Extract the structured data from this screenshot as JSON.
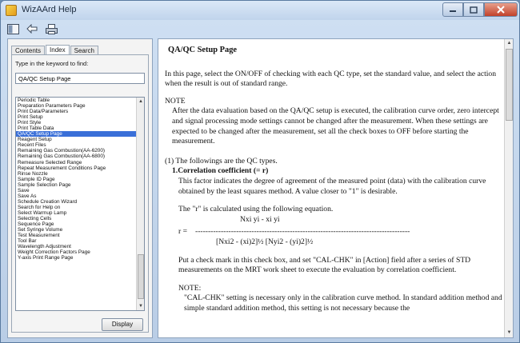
{
  "window": {
    "title": "WizAArd Help"
  },
  "toolbar": {
    "icons": [
      "hide-pane-icon",
      "back-icon",
      "print-icon"
    ]
  },
  "nav": {
    "tabs": [
      "Contents",
      "Index",
      "Search"
    ],
    "active_tab": "Index",
    "keyword_label": "Type in the keyword to find:",
    "keyword_value": "QA/QC Setup Page",
    "items": [
      "Periodic Table",
      "Preparation Parameters Page",
      "Print Data/Parameters",
      "Print Setup",
      "Print Style",
      "Print Table Data",
      "QA/QC Setup Page",
      "Reagent Setup",
      "Recent Files",
      "Remaining Gas Combustion(AA-6200)",
      "Remaining Gas Combustion(AA-6800)",
      "Remeasure Selected Range",
      "Repeat Measurement Conditions Page",
      "Rinse Nozzle",
      "Sample ID Page",
      "Sample Selection Page",
      "Save",
      "Save As",
      "Schedule Creation Wizard",
      "Search for Help on",
      "Select Warmup Lamp",
      "Selecting Cells",
      "Sequence Page",
      "Set Syringe Volume",
      "Test Measurement",
      "Tool Bar",
      "Wavelength Adjustment",
      "Weight Correction Factors Page",
      "Y-axis Print Range Page"
    ],
    "selected_index": 6,
    "display_label": "Display"
  },
  "doc": {
    "title": "QA/QC Setup Page",
    "intro": "In this page, select the ON/OFF of checking with each QC type, set the standard value, and select the action when the result is out of standard range.",
    "note_heading": "NOTE",
    "note_text": "After the data evaluation based on the QA/QC setup is executed, the calibration curve order, zero intercept and signal processing mode settings cannot be changed after the measurement. When these settings are expected to be changed after the measurement, set all the check boxes to OFF before starting the measurement.",
    "types_heading": "(1) The followings are the QC types.",
    "item1_heading": "1.Correlation coefficient (= r)",
    "item1_desc": "This factor indicates the degree of agreement of the measured point (data) with the calibration curve obtained by the least squares method. A value closer to \"1\" is desirable.",
    "r_calc": "The \"r\" is calculated using the following equation.",
    "formula_numerator": "Nxi yi - xi yi",
    "formula_r": "r =",
    "formula_dashes": "------------------------------------------------------------------------------------",
    "formula_denominator": "[Nxi2 - (xi)2]½ [Nyi2 - (yi)2]½",
    "check_text": "Put a check mark in this check box, and set \"CAL-CHK\" in [Action] field after a series of STD measurements on the MRT work sheet to execute the evaluation by correlation coefficient.",
    "note2_heading": "NOTE:",
    "note2_text": "\"CAL-CHK\" setting is necessary only in the calibration curve method. In standard addition method and simple standard addition method, this setting is not necessary because the"
  }
}
